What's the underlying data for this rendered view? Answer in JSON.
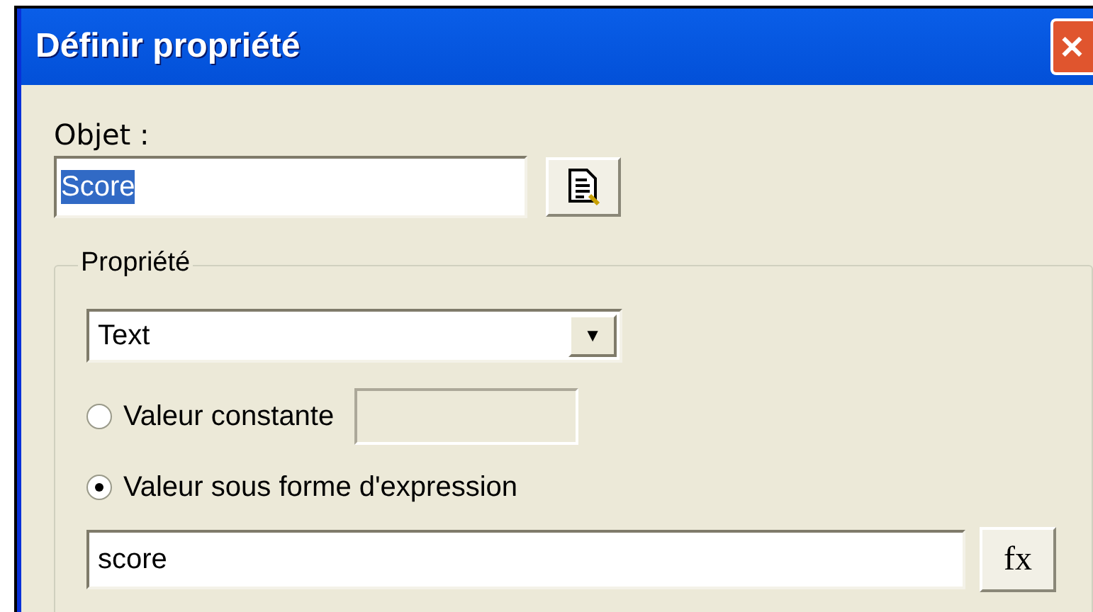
{
  "window": {
    "title": "Définir propriété",
    "close_button": "✕"
  },
  "object": {
    "label": "Objet :",
    "value": "Score",
    "value_selected": true
  },
  "property_group": {
    "legend": "Propriété",
    "dropdown": {
      "value": "Text",
      "arrow": "▼"
    },
    "options": [
      {
        "label": "Valeur constante",
        "selected": false
      },
      {
        "label": "Valeur sous forme d'expression",
        "selected": true
      }
    ],
    "expression": {
      "value": "score"
    },
    "fx_button": "fx"
  }
}
